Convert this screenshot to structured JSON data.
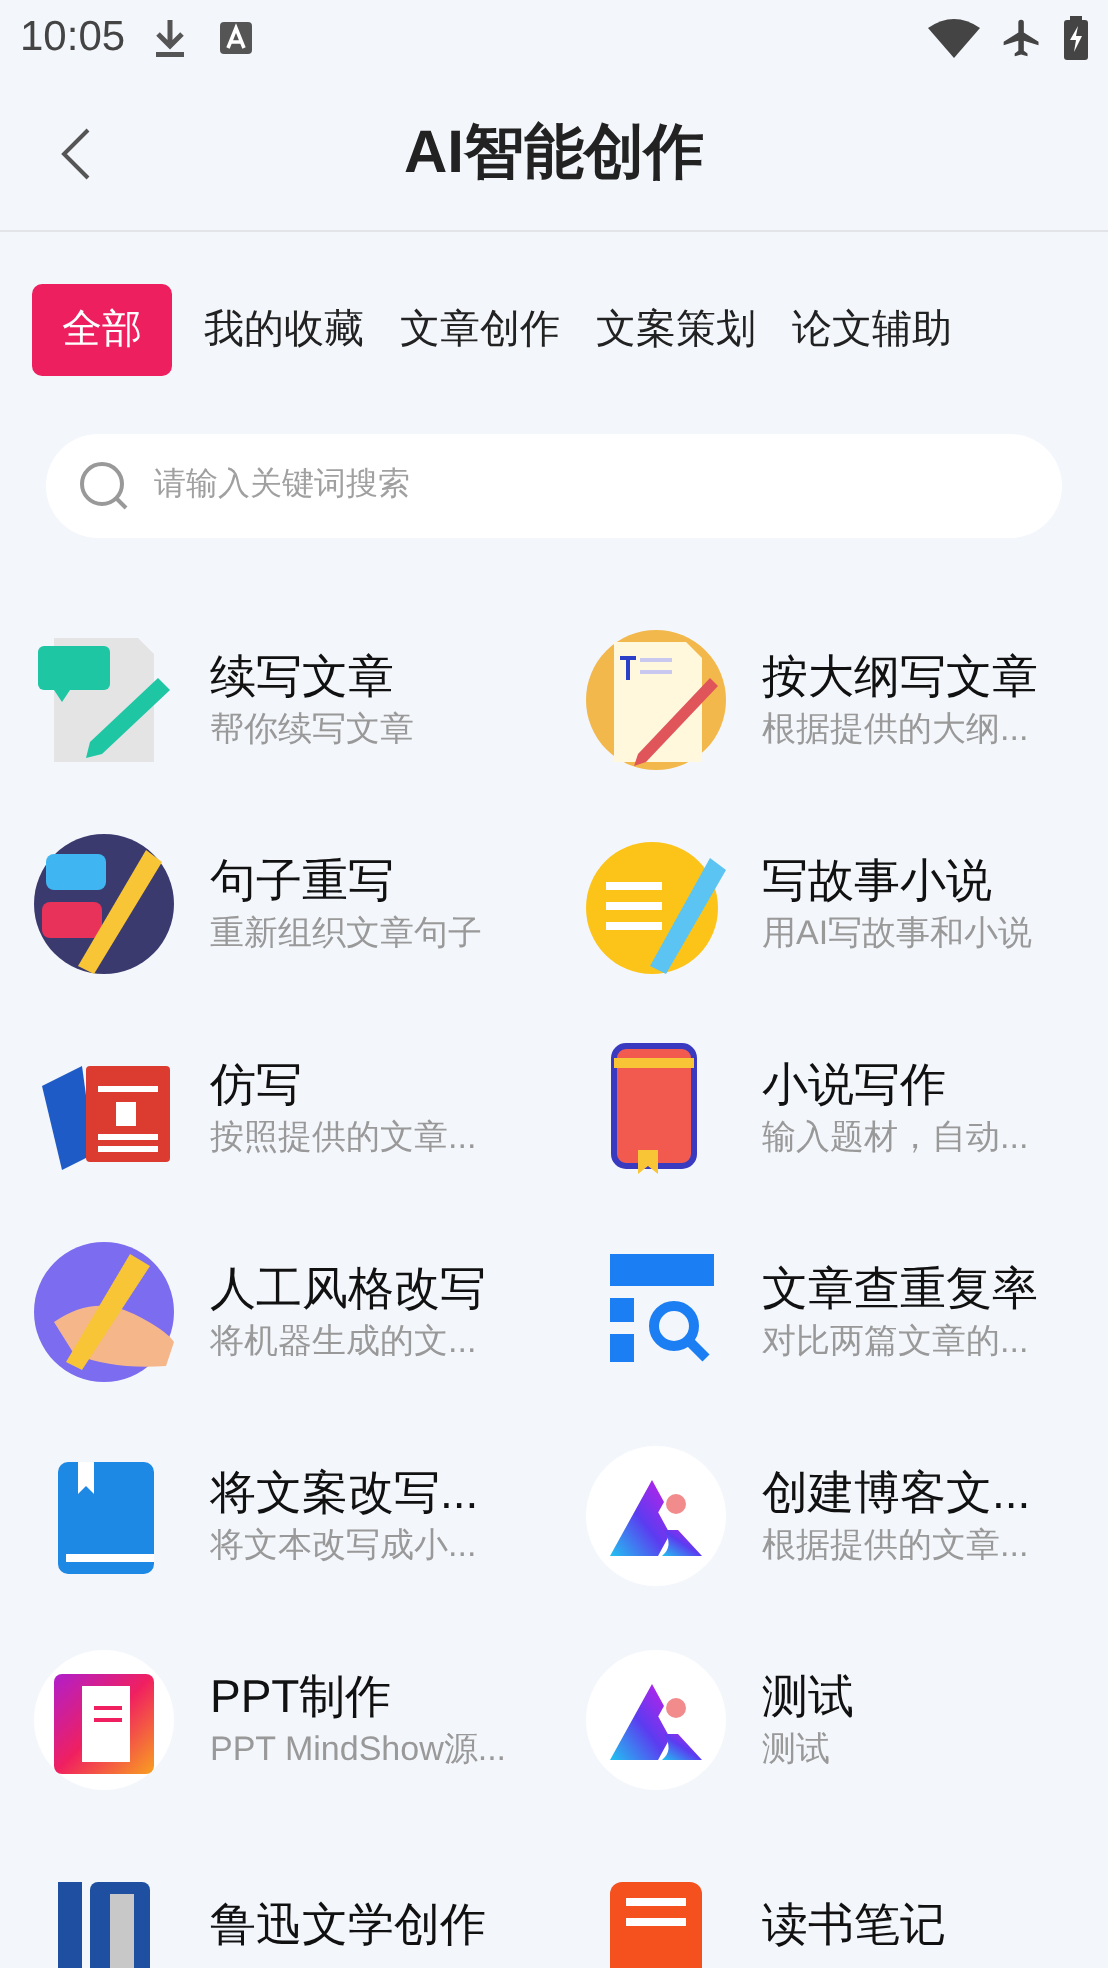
{
  "status_bar": {
    "time": "10:05"
  },
  "header": {
    "title": "AI智能创作"
  },
  "tabs": [
    {
      "label": "全部",
      "selected": true
    },
    {
      "label": "我的收藏",
      "selected": false
    },
    {
      "label": "文章创作",
      "selected": false
    },
    {
      "label": "文案策划",
      "selected": false
    },
    {
      "label": "论文辅助",
      "selected": false
    }
  ],
  "search": {
    "placeholder": "请输入关键词搜索"
  },
  "tools": [
    {
      "title": "续写文章",
      "subtitle": "帮你续写文章"
    },
    {
      "title": "按大纲写文章",
      "subtitle": "根据提供的大纲..."
    },
    {
      "title": "句子重写",
      "subtitle": "重新组织文章句子"
    },
    {
      "title": "写故事小说",
      "subtitle": "用AI写故事和小说"
    },
    {
      "title": "仿写",
      "subtitle": "按照提供的文章..."
    },
    {
      "title": "小说写作",
      "subtitle": "输入题材，自动..."
    },
    {
      "title": "人工风格改写",
      "subtitle": "将机器生成的文..."
    },
    {
      "title": "文章查重复率",
      "subtitle": "对比两篇文章的..."
    },
    {
      "title": "将文案改写...",
      "subtitle": "将文本改写成小..."
    },
    {
      "title": "创建博客文...",
      "subtitle": "根据提供的文章..."
    },
    {
      "title": "PPT制作",
      "subtitle": "PPT MindShow源..."
    },
    {
      "title": "测试",
      "subtitle": "测试"
    },
    {
      "title": "鲁迅文学创作"
    },
    {
      "title": "读书笔记"
    }
  ]
}
